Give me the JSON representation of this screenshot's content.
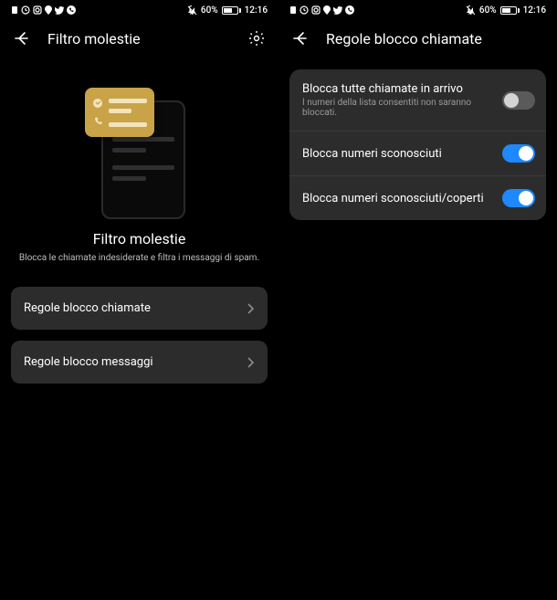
{
  "status": {
    "battery_pct": "60%",
    "time": "12:16",
    "battery_fill_pct": 60
  },
  "left": {
    "header_title": "Filtro molestie",
    "feature_title": "Filtro molestie",
    "feature_sub": "Blocca le chiamate indesiderate e filtra i messaggi di spam.",
    "rows": [
      {
        "label": "Regole blocco chiamate"
      },
      {
        "label": "Regole blocco messaggi"
      }
    ]
  },
  "right": {
    "header_title": "Regole blocco chiamate",
    "settings": [
      {
        "title": "Blocca tutte chiamate in arrivo",
        "sub": "I numeri della lista consentiti non saranno bloccati.",
        "on": false
      },
      {
        "title": "Blocca numeri sconosciuti",
        "sub": "",
        "on": true
      },
      {
        "title": "Blocca numeri sconosciuti/coperti",
        "sub": "",
        "on": true
      }
    ]
  }
}
